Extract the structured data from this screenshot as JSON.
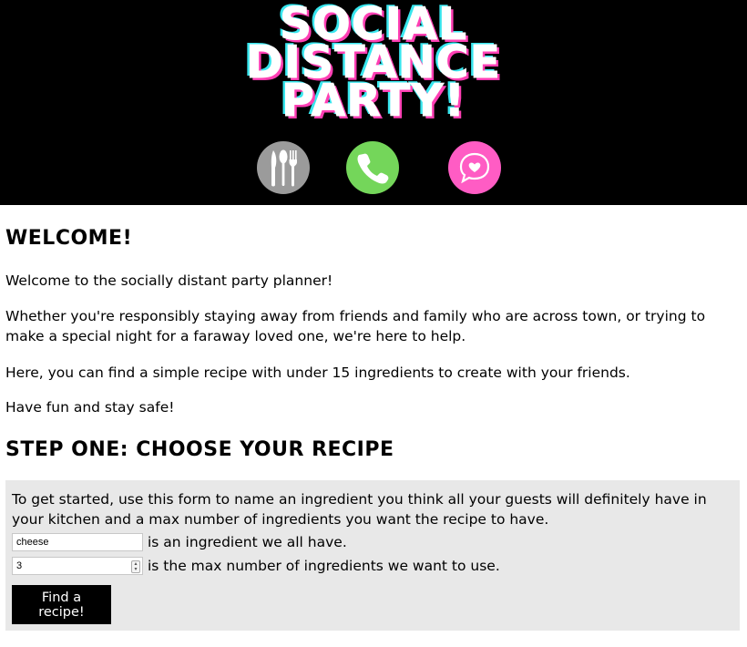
{
  "header": {
    "logo_lines": [
      "SOCIAL",
      "DISTANCE",
      "PARTY!"
    ],
    "icons": [
      {
        "name": "dining-utensils-icon",
        "color": "#9b9b9b"
      },
      {
        "name": "phone-icon",
        "color": "#74d65a"
      },
      {
        "name": "heart-chat-icon",
        "color": "#ff5cc4"
      }
    ]
  },
  "welcome": {
    "heading": "WELCOME!",
    "paragraphs": [
      "Welcome to the socially distant party planner!",
      "Whether you're responsibly staying away from friends and family who are across town, or trying to make a special night for a faraway loved one, we're here to help.",
      "Here, you can find a simple recipe with under 15 ingredients to create with your friends.",
      "Have fun and stay safe!"
    ]
  },
  "step_one": {
    "heading": "STEP ONE: CHOOSE YOUR RECIPE",
    "intro": "To get started, use this form to name an ingredient you think all your guests will definitely have in your kitchen and a max number of ingredients you want the recipe to have.",
    "ingredient_value": "cheese",
    "ingredient_label": "is an ingredient we all have.",
    "max_value": "3",
    "max_label": "is the max number of ingredients we want to use.",
    "button_label": "Find a recipe!"
  },
  "colors": {
    "header_bg": "#000000",
    "form_bg": "#e8e8e8",
    "button_bg": "#000000",
    "logo_shadow_pink": "#ff3fb4",
    "logo_shadow_cyan": "#38e6ee"
  }
}
